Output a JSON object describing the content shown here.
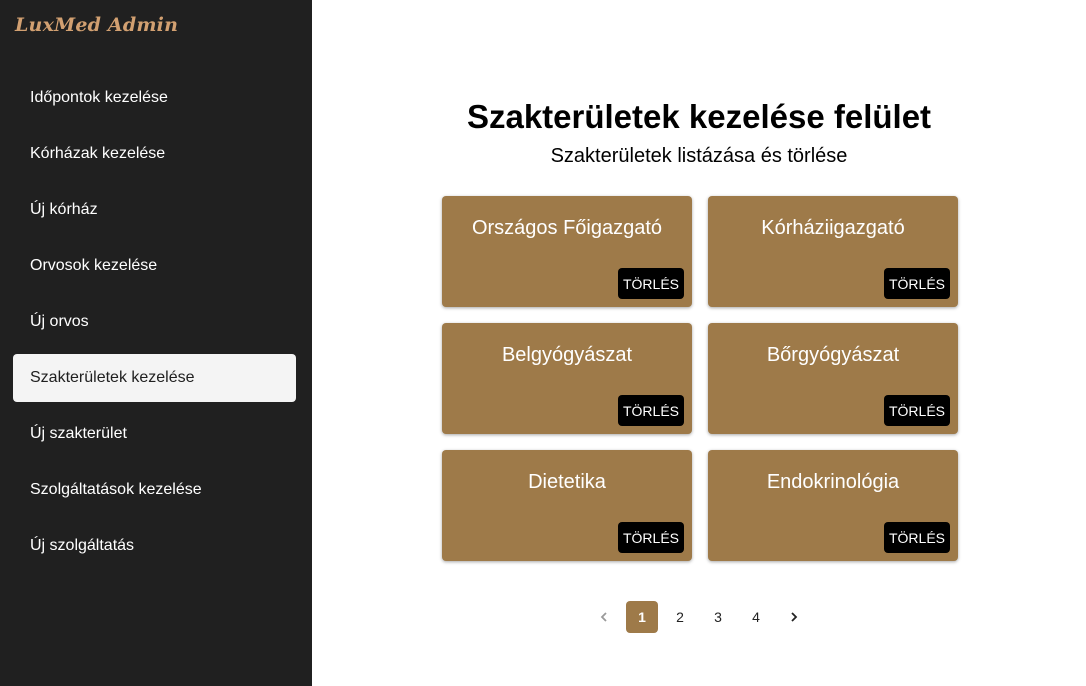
{
  "sidebar": {
    "brand": "LuxMed Admin",
    "items": [
      {
        "label": "Időpontok kezelése"
      },
      {
        "label": "Kórházak kezelése"
      },
      {
        "label": "Új kórház"
      },
      {
        "label": "Orvosok kezelése"
      },
      {
        "label": "Új orvos"
      },
      {
        "label": "Szakterületek kezelése"
      },
      {
        "label": "Új szakterület"
      },
      {
        "label": "Szolgáltatások kezelése"
      },
      {
        "label": "Új szolgáltatás"
      }
    ],
    "active_item": "Szakterületek kezelése"
  },
  "main": {
    "title": "Szakterületek kezelése felület",
    "subtitle": "Szakterületek listázása és törlése",
    "cards": [
      {
        "title": "Országos Főigazgató",
        "delete_label": "TÖRLÉS"
      },
      {
        "title": "Kórháziigazgató",
        "delete_label": "TÖRLÉS"
      },
      {
        "title": "Belgyógyászat",
        "delete_label": "TÖRLÉS"
      },
      {
        "title": "Bőrgyógyászat",
        "delete_label": "TÖRLÉS"
      },
      {
        "title": "Dietetika",
        "delete_label": "TÖRLÉS"
      },
      {
        "title": "Endokrinológia",
        "delete_label": "TÖRLÉS"
      }
    ]
  },
  "pagination": {
    "pages": [
      "1",
      "2",
      "3",
      "4"
    ],
    "current": "1",
    "prev_icon": "chevron-left-icon",
    "next_icon": "chevron-right-icon"
  },
  "colors": {
    "sidebar_bg": "#202020",
    "brand": "#d2a071",
    "card_bg": "#9e7a49",
    "active_page": "#9e7a49"
  }
}
